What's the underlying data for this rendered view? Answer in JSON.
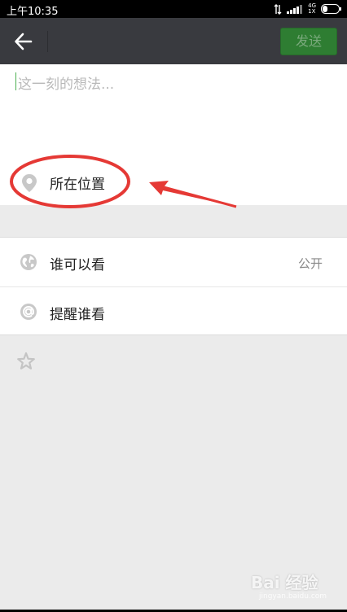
{
  "status_bar": {
    "time": "上午10:35",
    "network": "4G",
    "network_sub": "1X",
    "icons": [
      "data-arrows-icon",
      "signal-icon",
      "battery-icon"
    ]
  },
  "title_bar": {
    "back_icon": "back-arrow-icon",
    "send_label": "发送"
  },
  "compose": {
    "placeholder": "这一刻的想法...",
    "location_label": "所在位置",
    "location_icon": "location-pin-icon"
  },
  "settings": {
    "items": [
      {
        "label": "谁可以看",
        "value": "公开",
        "icon": "globe-icon"
      },
      {
        "label": "提醒谁看",
        "icon": "at-icon"
      }
    ],
    "star_icon": "star-icon"
  },
  "watermark": {
    "text": "Bai 经验",
    "sub": "jingyan.baidu.com"
  },
  "colors": {
    "title_bar": "#393a3f",
    "send_button": "#2e7d32",
    "background": "#ebebeb",
    "annotation": "#e53935"
  }
}
